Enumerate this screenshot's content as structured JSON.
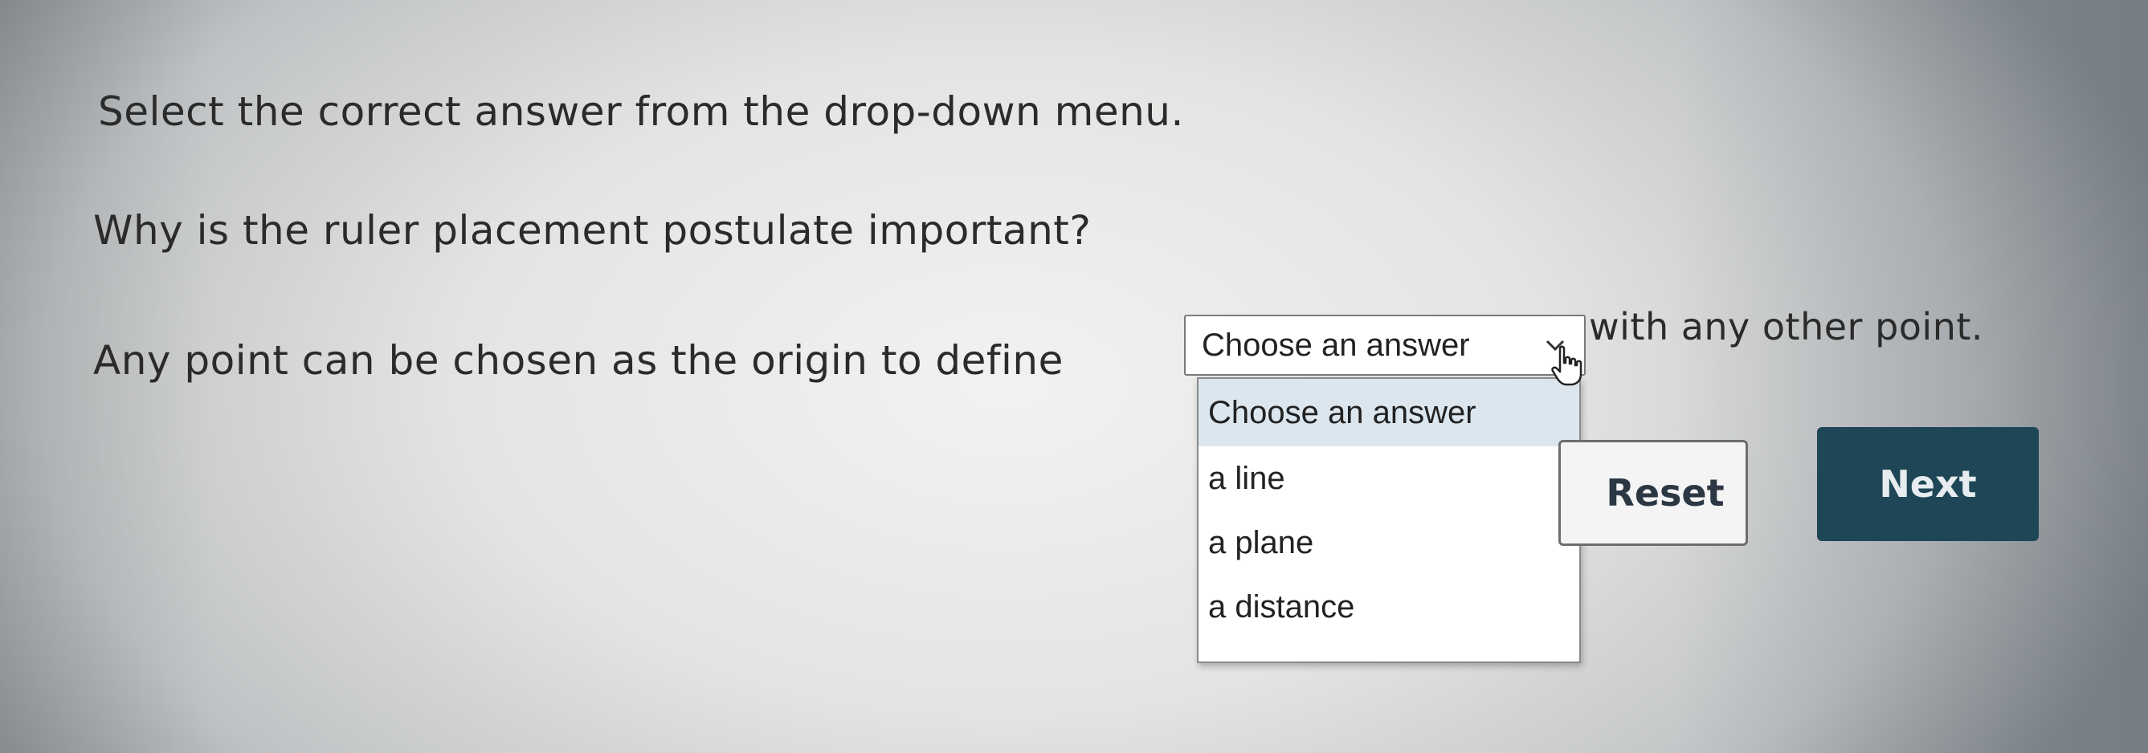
{
  "instruction": "Select the correct answer from the drop-down menu.",
  "question": "Why is the ruler placement postulate important?",
  "sentence": {
    "before": "Any point can be chosen as the origin to define",
    "after": "with any other point."
  },
  "dropdown": {
    "selected_value": "Choose an answer",
    "expanded": true,
    "options": [
      "Choose an answer",
      "a line",
      "a plane",
      "a distance"
    ],
    "highlighted_index": 0
  },
  "buttons": {
    "reset_label": "Reset",
    "next_label": "Next"
  },
  "icons": {
    "dropdown_arrow": "chevron-down-icon",
    "cursor": "hand-pointer-icon"
  },
  "colors": {
    "next_button_bg": "#1f4656",
    "option_highlight": "#dce6ee",
    "reset_border": "#6d6d6d"
  }
}
